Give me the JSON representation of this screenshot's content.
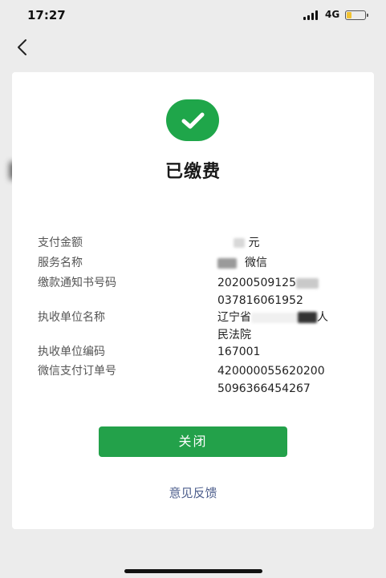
{
  "status_bar": {
    "time": "17:27",
    "network": "4G"
  },
  "nav": {
    "back_icon": "chevron-left-icon"
  },
  "result": {
    "icon": "check-icon",
    "icon_color": "#1fa64a",
    "title": "已缴费"
  },
  "details": {
    "amount_label": "支付金额",
    "amount_unit": "元",
    "service_label": "服务名称",
    "service_value": "微信",
    "notice_label": "缴款通知书号码",
    "notice_line1": "20200509125",
    "notice_line2": "037816061952",
    "unit_name_label": "执收单位名称",
    "unit_name_part1": "辽宁省",
    "unit_name_part2": "人",
    "unit_name_line2": "民法院",
    "unit_code_label": "执收单位编码",
    "unit_code_value": "167001",
    "order_label": "微信支付订单号",
    "order_line1": "420000055620200",
    "order_line2": "5096366454267"
  },
  "actions": {
    "close_label": "关闭",
    "close_color": "#23a14a",
    "feedback_label": "意见反馈",
    "feedback_color": "#4d5e8c"
  }
}
